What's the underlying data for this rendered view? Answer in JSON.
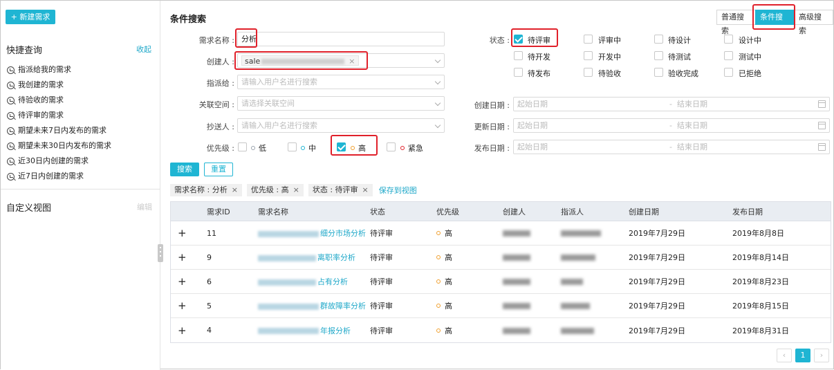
{
  "sidebar": {
    "new_button": "+ 新建需求",
    "quick_title": "快捷查询",
    "collapse": "收起",
    "quick_items": [
      {
        "label": "指派给我的需求"
      },
      {
        "label": "我创建的需求"
      },
      {
        "label": "待验收的需求"
      },
      {
        "label": "待评审的需求"
      },
      {
        "label": "期望未来7日内发布的需求"
      },
      {
        "label": "期望未来30日内发布的需求"
      },
      {
        "label": "近30日内创建的需求"
      },
      {
        "label": "近7日内创建的需求"
      }
    ],
    "custom_title": "自定义视图",
    "edit": "编辑"
  },
  "header": {
    "title": "条件搜索",
    "tabs": [
      "普通搜索",
      "条件搜索",
      "高级搜索"
    ]
  },
  "form": {
    "name_label": "需求名称 :",
    "name_value": "分析",
    "creator_label": "创建人 :",
    "creator_tag": "sale",
    "assignee_label": "指派给 :",
    "assignee_placeholder": "请输入用户名进行搜索",
    "space_label": "关联空间 :",
    "space_placeholder": "请选择关联空间",
    "cc_label": "抄送人 :",
    "cc_placeholder": "请输入用户名进行搜索",
    "priority_label": "优先级 :",
    "priorities": [
      {
        "label": "低",
        "checked": false,
        "color": "#9aa3ad"
      },
      {
        "label": "中",
        "checked": false,
        "color": "#1fb5d3"
      },
      {
        "label": "高",
        "checked": true,
        "color": "#f0a030"
      },
      {
        "label": "紧急",
        "checked": false,
        "color": "#e0202a"
      }
    ],
    "status_label": "状态 :",
    "statuses": [
      {
        "label": "待评审",
        "checked": true
      },
      {
        "label": "评审中",
        "checked": false
      },
      {
        "label": "待设计",
        "checked": false
      },
      {
        "label": "设计中",
        "checked": false
      },
      {
        "label": "待开发",
        "checked": false
      },
      {
        "label": "开发中",
        "checked": false
      },
      {
        "label": "待测试",
        "checked": false
      },
      {
        "label": "测试中",
        "checked": false
      },
      {
        "label": "待发布",
        "checked": false
      },
      {
        "label": "待验收",
        "checked": false
      },
      {
        "label": "验收完成",
        "checked": false
      },
      {
        "label": "已拒绝",
        "checked": false
      }
    ],
    "created_label": "创建日期 :",
    "updated_label": "更新日期 :",
    "release_label": "发布日期 :",
    "date_start": "起始日期",
    "date_sep": "-",
    "date_end": "结束日期",
    "search_button": "搜索",
    "reset_button": "重置"
  },
  "chips": [
    "需求名称 : 分析",
    "优先级 : 高",
    "状态 : 待评审"
  ],
  "chip_close": "×",
  "save_view": "保存到视图",
  "table": {
    "columns": [
      "需求ID",
      "需求名称",
      "状态",
      "优先级",
      "创建人",
      "指派人",
      "创建日期",
      "发布日期"
    ],
    "rows": [
      {
        "id": "11",
        "name": "细分市场分析",
        "status": "待评审",
        "priority": "高",
        "created": "2019年7月29日",
        "release": "2019年8月8日"
      },
      {
        "id": "9",
        "name": "离职率分析",
        "status": "待评审",
        "priority": "高",
        "created": "2019年7月29日",
        "release": "2019年8月14日"
      },
      {
        "id": "6",
        "name": "占有分析",
        "status": "待评审",
        "priority": "高",
        "created": "2019年7月29日",
        "release": "2019年8月23日"
      },
      {
        "id": "5",
        "name": "群故障率分析",
        "status": "待评审",
        "priority": "高",
        "created": "2019年7月29日",
        "release": "2019年8月15日"
      },
      {
        "id": "4",
        "name": "年报分析",
        "status": "待评审",
        "priority": "高",
        "created": "2019年7月29日",
        "release": "2019年8月31日"
      }
    ]
  },
  "pagination": {
    "prev": "‹",
    "current": "1",
    "next": "›"
  }
}
